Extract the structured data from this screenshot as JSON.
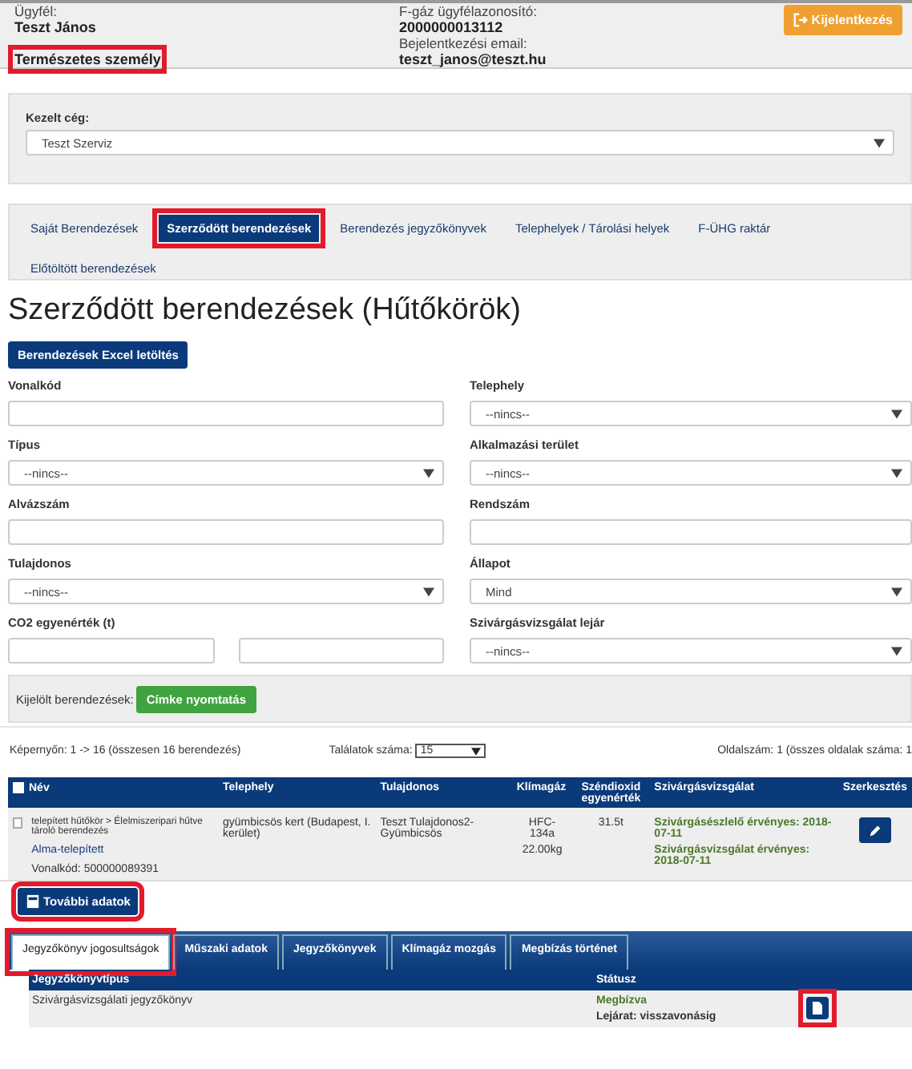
{
  "header": {
    "client_label": "Ügyfél:",
    "client_name": "Teszt János",
    "client_type": {
      "value": "Természetes személy",
      "highlighted": true
    },
    "fgas_label": "F-gáz ügyfélazonosító:",
    "fgas_id": "2000000013112",
    "email_label": "Bejelentkezési email:",
    "email": "teszt_janos@teszt.hu",
    "logout": "Kijelentkezés"
  },
  "company": {
    "label": "Kezelt cég:",
    "value": "Teszt Szerviz"
  },
  "nav_tabs": [
    {
      "label": "Saját Berendezések",
      "selected": false,
      "highlighted": false
    },
    {
      "label": "Szerződött berendezések",
      "selected": true,
      "highlighted": true
    },
    {
      "label": "Berendezés jegyzőkönyvek",
      "selected": false,
      "highlighted": false
    },
    {
      "label": "Telephelyek / Tárolási helyek",
      "selected": false,
      "highlighted": false
    },
    {
      "label": "F-ÜHG raktár",
      "selected": false,
      "highlighted": false
    },
    {
      "label": "Előtöltött berendezések",
      "selected": false,
      "highlighted": false
    }
  ],
  "heading": "Szerződött berendezések (Hűtőkörök)",
  "excel_button": "Berendezések Excel letöltés",
  "filters": [
    {
      "label": "Vonalkód",
      "kind": "text"
    },
    {
      "label": "Telephely",
      "kind": "select",
      "value": "--nincs--"
    },
    {
      "label": "Típus",
      "kind": "select",
      "value": "--nincs--"
    },
    {
      "label": "Alkalmazási terület",
      "kind": "select",
      "value": "--nincs--"
    },
    {
      "label": "Alvázszám",
      "kind": "text"
    },
    {
      "label": "Rendszám",
      "kind": "text"
    },
    {
      "label": "Tulajdonos",
      "kind": "select",
      "value": "--nincs--"
    },
    {
      "label": "Állapot",
      "kind": "select",
      "value": "Mind"
    },
    {
      "label": "CO2 egyenérték (t)",
      "kind": "range"
    },
    {
      "label": "Szivárgásvizsgálat lejár",
      "kind": "select",
      "value": "--nincs--"
    }
  ],
  "selected_bar": {
    "label": "Kijelölt berendezések:",
    "button": "Címke nyomtatás"
  },
  "pagination": {
    "summary": "Képernyőn: 1 -> 16 (összesen 16 berendezés)",
    "page_size_label": "Találatok száma:",
    "page_size": "15",
    "page_info": "Oldalszám: 1 (összes oldalak száma: 1"
  },
  "table": {
    "select_all_checked": false,
    "columns": [
      "Név",
      "Telephely",
      "Tulajdonos",
      "Klímagáz",
      "Széndioxid egyenérték",
      "Szivárgásvizsgálat",
      "Szerkesztés"
    ],
    "rows": [
      {
        "checked": false,
        "type_path": "telepített hűtőkör > Élelmiszeripari hűtve tároló berendezés",
        "name_link": "Alma-telepített",
        "barcode": "Vonalkód: 500000089391",
        "site": "gyümbicsös kert (Budapest, I. kerület)",
        "owner": "Teszt Tulajdonos2-Gyümbicsös",
        "gas": "HFC-134a",
        "gas_amount": "22.00kg",
        "co2": "31.5t",
        "leak": [
          "Szivárgásészlelő érvényes: 2018-07-11",
          "Szivárgásvizsgálat érvényes: 2018-07-11"
        ]
      }
    ]
  },
  "more_button": {
    "label": "További adatok",
    "highlighted": true
  },
  "sub_tabs": [
    {
      "label": "Jegyzőkönyv jogosultságok",
      "selected": true,
      "highlighted": true
    },
    {
      "label": "Műszaki adatok",
      "selected": false,
      "highlighted": false
    },
    {
      "label": "Jegyzőkönyvek",
      "selected": false,
      "highlighted": false
    },
    {
      "label": "Klímagáz mozgás",
      "selected": false,
      "highlighted": false
    },
    {
      "label": "Megbízás történet",
      "selected": false,
      "highlighted": false
    }
  ],
  "sub_table": {
    "columns": [
      "Jegyzőkönyvtípus",
      "Státusz"
    ],
    "rows": [
      {
        "type": "Szivárgásvizsgálati jegyzőkönyv",
        "status": "Megbízva",
        "expiry": "Lejárat: visszavonásig",
        "icon_highlighted": true
      }
    ]
  }
}
